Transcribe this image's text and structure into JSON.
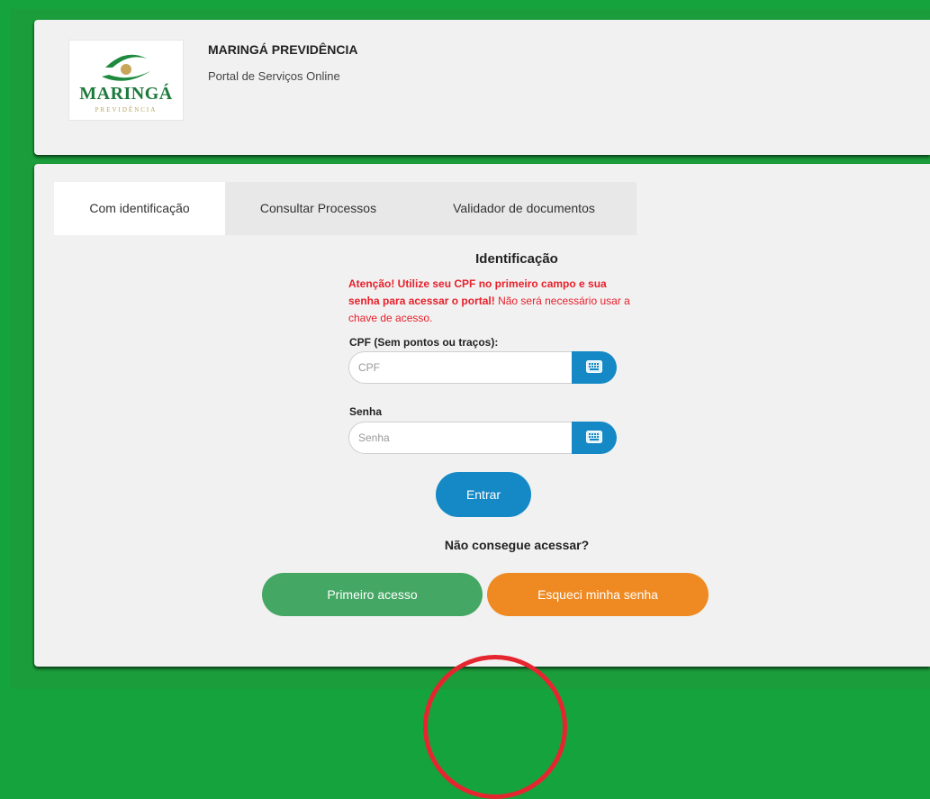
{
  "header": {
    "logo_text": "MARINGÁ",
    "logo_subtext": "PREVIDÊNCIA",
    "org_name": "MARINGÁ PREVIDÊNCIA",
    "subtitle": "Portal de Serviços Online"
  },
  "tabs": [
    {
      "label": "Com identificação",
      "active": true
    },
    {
      "label": "Consultar Processos",
      "active": false
    },
    {
      "label": "Validador de documentos",
      "active": false
    }
  ],
  "form": {
    "title": "Identificação",
    "warning_bold": "Atenção! Utilize seu CPF no primeiro campo e sua senha para acessar o portal!",
    "warning_normal": " Não será necessário usar a chave de acesso.",
    "cpf_label": "CPF (Sem pontos ou traços):",
    "cpf_placeholder": "CPF",
    "cpf_value": "",
    "password_label": "Senha",
    "password_placeholder": "Senha",
    "password_value": "",
    "keyboard_icon": "keyboard-icon",
    "submit_label": "Entrar"
  },
  "help": {
    "title": "Não consegue acessar?",
    "first_access_label": "Primeiro acesso",
    "forgot_password_label": "Esqueci minha senha"
  },
  "colors": {
    "frame_green": "#15a33e",
    "primary_blue": "#1589c6",
    "success_green": "#45a764",
    "warning_orange": "#ef8a22",
    "alert_red": "#e8202b",
    "annotation_red": "#e6262f"
  }
}
